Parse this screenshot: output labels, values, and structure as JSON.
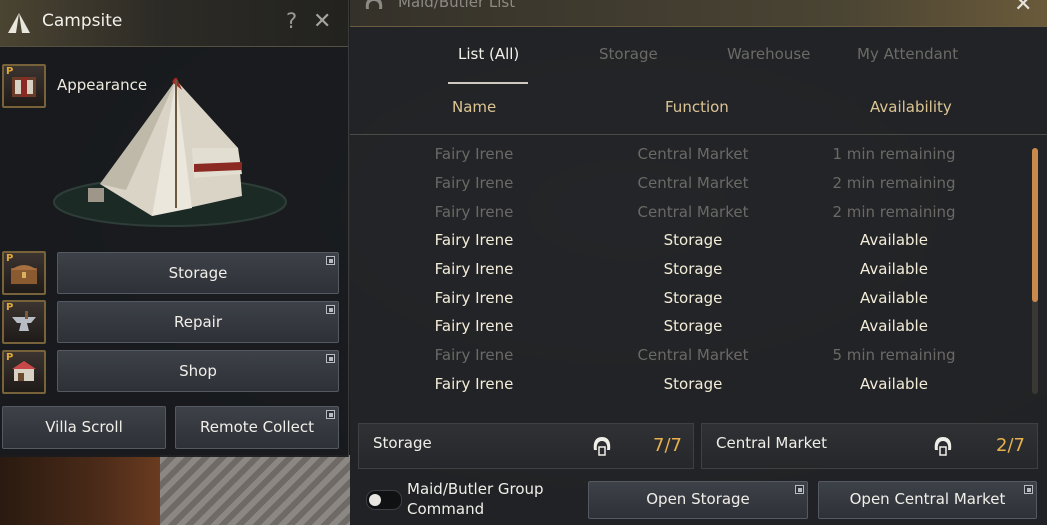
{
  "campsite": {
    "title": "Campsite",
    "help_glyph": "?",
    "close_glyph": "✕",
    "appearance_label": "Appearance",
    "slot_badge": "P",
    "buttons": {
      "storage": "Storage",
      "repair": "Repair",
      "shop": "Shop",
      "villa_scroll": "Villa Scroll",
      "remote_collect": "Remote Collect"
    },
    "icons": [
      "tent-icon",
      "appearance-item-icon",
      "chest-icon",
      "anvil-icon",
      "market-stall-icon",
      "external-link-icon"
    ]
  },
  "maid_list": {
    "title": "Maid/Butler List",
    "close_glyph": "✕",
    "tabs": [
      "List (All)",
      "Storage",
      "Warehouse",
      "My Attendant"
    ],
    "columns": [
      "Name",
      "Function",
      "Availability"
    ],
    "rows": [
      {
        "name": "Fairy Irene",
        "function": "Central Market",
        "availability": "1 min remaining",
        "state": "busy"
      },
      {
        "name": "Fairy Irene",
        "function": "Central Market",
        "availability": "2 min remaining",
        "state": "busy"
      },
      {
        "name": "Fairy Irene",
        "function": "Central Market",
        "availability": "2 min remaining",
        "state": "busy"
      },
      {
        "name": "Fairy Irene",
        "function": "Storage",
        "availability": "Available",
        "state": "available"
      },
      {
        "name": "Fairy Irene",
        "function": "Storage",
        "availability": "Available",
        "state": "available"
      },
      {
        "name": "Fairy Irene",
        "function": "Storage",
        "availability": "Available",
        "state": "available"
      },
      {
        "name": "Fairy Irene",
        "function": "Storage",
        "availability": "Available",
        "state": "available"
      },
      {
        "name": "Fairy Irene",
        "function": "Central Market",
        "availability": "5 min remaining",
        "state": "busy"
      },
      {
        "name": "Fairy Irene",
        "function": "Storage",
        "availability": "Available",
        "state": "available"
      }
    ],
    "summary": {
      "storage_label": "Storage",
      "storage_count": "7/7",
      "market_label": "Central Market",
      "market_count": "2/7"
    },
    "group_command_label_line1": "Maid/Butler Group",
    "group_command_label_line2": "Command",
    "group_command_enabled": false,
    "open_storage_label": "Open Storage",
    "open_market_label": "Open Central Market",
    "colors": {
      "available_text": "#f3ecd8",
      "busy_text": "#6b6966",
      "header_text": "#dcc594",
      "count_text": "#e7b14e",
      "scroll_thumb": "#c98a4c"
    }
  }
}
